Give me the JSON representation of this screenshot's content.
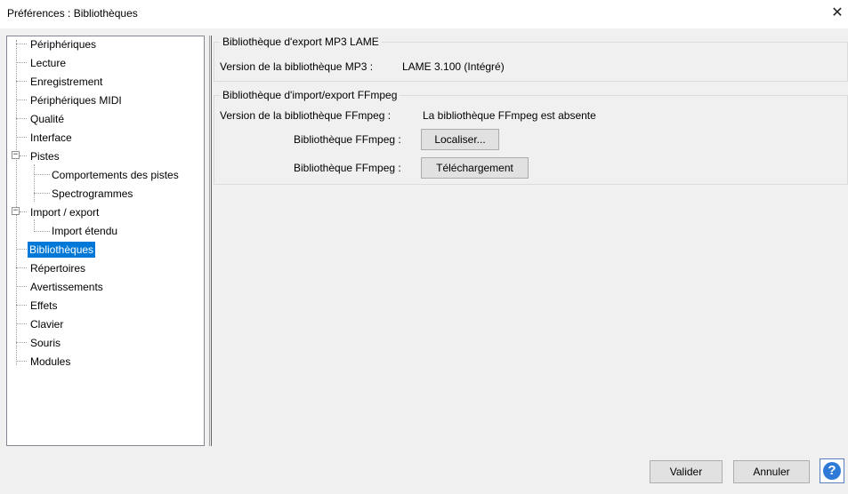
{
  "window": {
    "title": "Préférences : Bibliothèques",
    "close_glyph": "✕"
  },
  "tree": {
    "items": [
      {
        "label": "Périphériques",
        "level": 0
      },
      {
        "label": "Lecture",
        "level": 0
      },
      {
        "label": "Enregistrement",
        "level": 0
      },
      {
        "label": "Périphériques MIDI",
        "level": 0
      },
      {
        "label": "Qualité",
        "level": 0
      },
      {
        "label": "Interface",
        "level": 0
      },
      {
        "label": "Pistes",
        "level": 0,
        "expanded": true
      },
      {
        "label": "Comportements des pistes",
        "level": 1
      },
      {
        "label": "Spectrogrammes",
        "level": 1
      },
      {
        "label": "Import / export",
        "level": 0,
        "expanded": true
      },
      {
        "label": "Import étendu",
        "level": 1
      },
      {
        "label": "Bibliothèques",
        "level": 0,
        "selected": true
      },
      {
        "label": "Répertoires",
        "level": 0
      },
      {
        "label": "Avertissements",
        "level": 0
      },
      {
        "label": "Effets",
        "level": 0
      },
      {
        "label": "Clavier",
        "level": 0
      },
      {
        "label": "Souris",
        "level": 0
      },
      {
        "label": "Modules",
        "level": 0
      }
    ],
    "expander_glyph": "−"
  },
  "mp3": {
    "group_title": "Bibliothèque d'export MP3 LAME",
    "version_label": "Version de la bibliothèque MP3 :",
    "version_value": "LAME 3.100 (Intégré)"
  },
  "ffmpeg": {
    "group_title": "Bibliothèque d'import/export FFmpeg",
    "version_label": "Version de la bibliothèque FFmpeg :",
    "version_value": "La bibliothèque FFmpeg est absente",
    "locate_label": "Bibliothèque FFmpeg :",
    "locate_button": "Localiser...",
    "download_label": "Bibliothèque FFmpeg :",
    "download_button": "Téléchargement"
  },
  "footer": {
    "ok_button": "Valider",
    "cancel_button": "Annuler",
    "help_glyph": "?"
  },
  "colors": {
    "selection": "#0078d7",
    "help_icon": "#2f7ad6"
  }
}
